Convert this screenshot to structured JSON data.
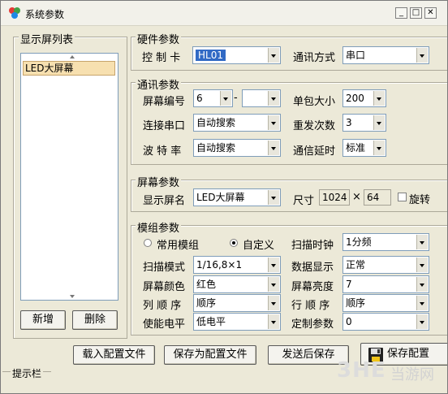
{
  "window": {
    "title": "系统参数",
    "min_label": "_",
    "max_label": "□",
    "close_label": "✕"
  },
  "left_panel": {
    "legend": "显示屏列表",
    "items": [
      "LED大屏幕"
    ],
    "add_label": "新增",
    "delete_label": "删除"
  },
  "hardware": {
    "legend": "硬件参数",
    "card_label": "控 制 卡",
    "card_value": "HL01",
    "comm_label": "通讯方式",
    "comm_value": "串口"
  },
  "comm": {
    "legend": "通讯参数",
    "screen_no_label": "屏幕编号",
    "screen_no_value": "6",
    "screen_no_dash": "-",
    "screen_no_value2": "",
    "packet_label": "单包大小",
    "packet_value": "200",
    "port_label": "连接串口",
    "port_value": "自动搜索",
    "resend_label": "重发次数",
    "resend_value": "3",
    "baud_label": "波 特 率",
    "baud_value": "自动搜索",
    "delay_label": "通信延时",
    "delay_value": "标准"
  },
  "screen": {
    "legend": "屏幕参数",
    "name_label": "显示屏名",
    "name_value": "LED大屏幕",
    "size_label": "尺寸",
    "width": "1024",
    "times": "×",
    "height": "64",
    "rotate_label": "旋转"
  },
  "module": {
    "legend": "模组参数",
    "common_label": "常用模组",
    "custom_label": "自定义",
    "selected": "custom",
    "scan_clock_label": "扫描时钟",
    "scan_clock_value": "1分频",
    "scan_mode_label": "扫描模式",
    "scan_mode_value": "1/16,8×1",
    "data_display_label": "数据显示",
    "data_display_value": "正常",
    "color_label": "屏幕颜色",
    "color_value": "红色",
    "brightness_label": "屏幕亮度",
    "brightness_value": "7",
    "col_order_label": "列 顺 序",
    "col_order_value": "顺序",
    "row_order_label": "行 顺 序",
    "row_order_value": "顺序",
    "enable_label": "使能电平",
    "enable_value": "低电平",
    "custom_param_label": "定制参数",
    "custom_param_value": "0"
  },
  "footer": {
    "load_label": "载入配置文件",
    "save_as_label": "保存为配置文件",
    "send_save_label": "发送后保存",
    "save_label": "保存配置",
    "status_label": "提示栏"
  },
  "watermark": {
    "text": "3HE",
    "text2": "当游网"
  }
}
